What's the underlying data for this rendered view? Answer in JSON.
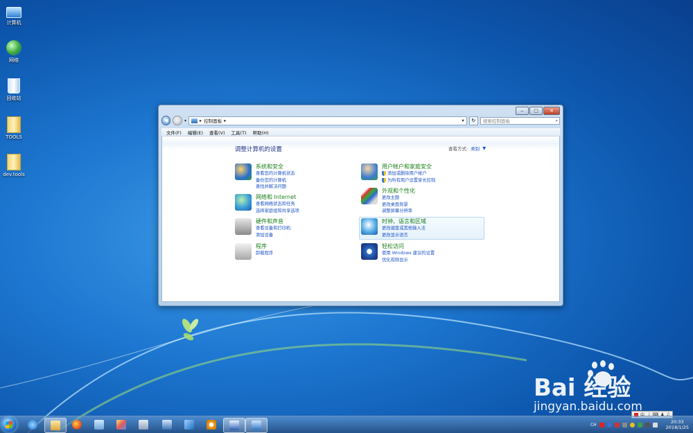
{
  "desktop": {
    "icons": [
      {
        "label": "计算机",
        "icon": "computer-icon"
      },
      {
        "label": "网络",
        "icon": "network-icon"
      },
      {
        "label": "回收站",
        "icon": "recycle-bin-icon"
      },
      {
        "label": "TOOLS",
        "icon": "folder-icon"
      },
      {
        "label": "dev.tools",
        "icon": "folder-icon"
      }
    ]
  },
  "window": {
    "caption": {
      "minimize": "‒",
      "maximize": "□",
      "close": "✕"
    },
    "address": {
      "crumb": "控制面板",
      "sep": "▸",
      "dropdown": "▾",
      "refresh": "↻"
    },
    "search_placeholder": "搜索控制面板",
    "menu": [
      "文件(F)",
      "编辑(E)",
      "查看(V)",
      "工具(T)",
      "帮助(H)"
    ],
    "title": "调整计算机的设置",
    "view_by": {
      "label": "查看方式:",
      "value": "类别",
      "arrow": "▼"
    },
    "categories": [
      {
        "title": "系统和安全",
        "icon": "security-shield-icon",
        "links": [
          "查看您的计算机状态",
          "备份您的计算机",
          "查找并解决问题"
        ]
      },
      {
        "title": "网络和 Internet",
        "icon": "network-globe-icon",
        "links": [
          "查看网络状态和任务",
          "选择家庭组和共享选项"
        ]
      },
      {
        "title": "硬件和声音",
        "icon": "printer-icon",
        "links": [
          "查看设备和打印机",
          "添加设备"
        ]
      },
      {
        "title": "程序",
        "icon": "programs-icon",
        "links": [
          "卸载程序"
        ]
      },
      {
        "title": "用户帐户和家庭安全",
        "icon": "users-icon",
        "links": [
          "添加或删除用户帐户",
          "为所有用户设置家长控制"
        ]
      },
      {
        "title": "外观和个性化",
        "icon": "appearance-icon",
        "links": [
          "更改主题",
          "更改桌面背景",
          "调整屏幕分辨率"
        ]
      },
      {
        "title": "时钟、语言和区域",
        "icon": "clock-globe-icon",
        "links": [
          "更改键盘或其他输入法",
          "更改显示语言"
        ]
      },
      {
        "title": "轻松访问",
        "icon": "ease-of-access-icon",
        "links": [
          "使用 Windows 建议的设置",
          "优化视频显示"
        ]
      }
    ]
  },
  "taskbar": {
    "tray_text": "CH",
    "time": "20:33",
    "date": "2018/1/25",
    "ime": [
      "中",
      "☽",
      "⌨",
      "♟",
      "♫"
    ]
  },
  "watermark": {
    "brand": "Bai  经验",
    "url": "jingyan.baidu.com"
  }
}
